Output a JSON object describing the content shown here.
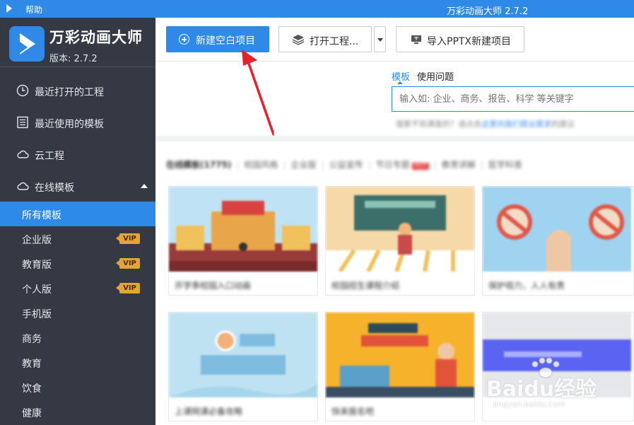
{
  "titlebar": {
    "help": "帮助",
    "title": "万彩动画大师 2.7.2"
  },
  "brand": {
    "name": "万彩动画大师",
    "version": "版本: 2.7.2"
  },
  "nav": {
    "recent_projects": "最近打开的工程",
    "recent_templates": "最近使用的模板",
    "cloud": "云工程",
    "online_templates": "在线模板"
  },
  "sub_items": {
    "all": "所有模板",
    "enterprise": "企业版",
    "education_ed": "教育版",
    "personal": "个人版",
    "mobile": "手机版",
    "business": "商务",
    "education": "教育",
    "food": "饮食",
    "health": "健康"
  },
  "vip_label": "VIP",
  "toolbar": {
    "new_blank": "新建空白项目",
    "open_project": "打开工程...",
    "import_pptx": "导入PPTX新建项目"
  },
  "search": {
    "tab_templates": "模板",
    "tab_help": "使用问题",
    "placeholder": "输入如: 企业、商务、报告、科学 等关键字",
    "hint_pre": "搜索不到满意的？请点击",
    "hint_link": "这里向我们提出需求",
    "hint_post": "的建议"
  },
  "categories": [
    "在线模板(1775)",
    "校园风格",
    "企业版",
    "公益宣传",
    "节日专题",
    "教育讲解",
    "医学科普"
  ],
  "categories_hot": "HOT",
  "cards": [
    {
      "caption": "开学季校园入口动画"
    },
    {
      "caption": "校园招生课程介绍"
    },
    {
      "caption": "保护视力，人人有责"
    },
    {
      "caption": "上课网课必备攻略"
    },
    {
      "caption": "快来报名吧"
    },
    {
      "caption": ""
    }
  ],
  "watermark": {
    "brand": "Baidu经验",
    "url": "jingyan.baidu.com"
  },
  "colors": {
    "primary": "#2e8ae6",
    "sidebar": "#353944",
    "vip": "#e3a533",
    "arrow": "#e8202a"
  }
}
